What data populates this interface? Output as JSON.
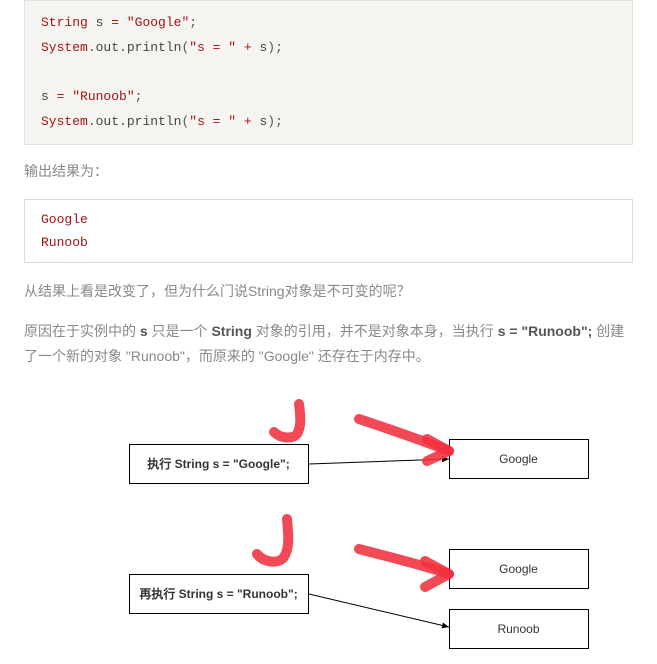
{
  "code1": {
    "line1_type": "String",
    "line1_var": "s",
    "line1_eq": " = ",
    "line1_str": "\"Google\"",
    "line1_semi": ";",
    "line2_sys": "System",
    "line2_dot1": ".",
    "line2_out": "out",
    "line2_dot2": ".",
    "line2_m": "println",
    "line2_paren1": "(",
    "line2_str": "\"s = \"",
    "line2_plus": " + ",
    "line2_var": "s",
    "line2_paren2": ")",
    "line2_semi": ";",
    "line3_var": "s",
    "line3_eq": " = ",
    "line3_str": "\"Runoob\"",
    "line3_semi": ";",
    "line4_sys": "System",
    "line4_dot1": ".",
    "line4_out": "out",
    "line4_dot2": ".",
    "line4_m": "println",
    "line4_paren1": "(",
    "line4_str": "\"s = \"",
    "line4_plus": " + ",
    "line4_var": "s",
    "line4_paren2": ")",
    "line4_semi": ";"
  },
  "output_label": "输出结果为：",
  "output": {
    "line1": "Google",
    "line2": "Runoob"
  },
  "para1": "从结果上看是改变了，但为什么门说String对象是不可变的呢？",
  "para2": {
    "t1": "原因在于实例中的 ",
    "b1": "s",
    "t2": " 只是一个 ",
    "b2": "String",
    "t3": " 对象的引用，并不是对象本身，当执行 ",
    "b3": "s = \"Runoob\";",
    "t4": " 创建了一个新的对象 \"Runoob\"，而原来的 \"Google\" 还存在于内存中。"
  },
  "diagram": {
    "box1": "执行 String s = \"Google\";",
    "box2": "再执行 String s = \"Runoob\";",
    "r1": "Google",
    "r2": "Google",
    "r3": "Runoob"
  }
}
